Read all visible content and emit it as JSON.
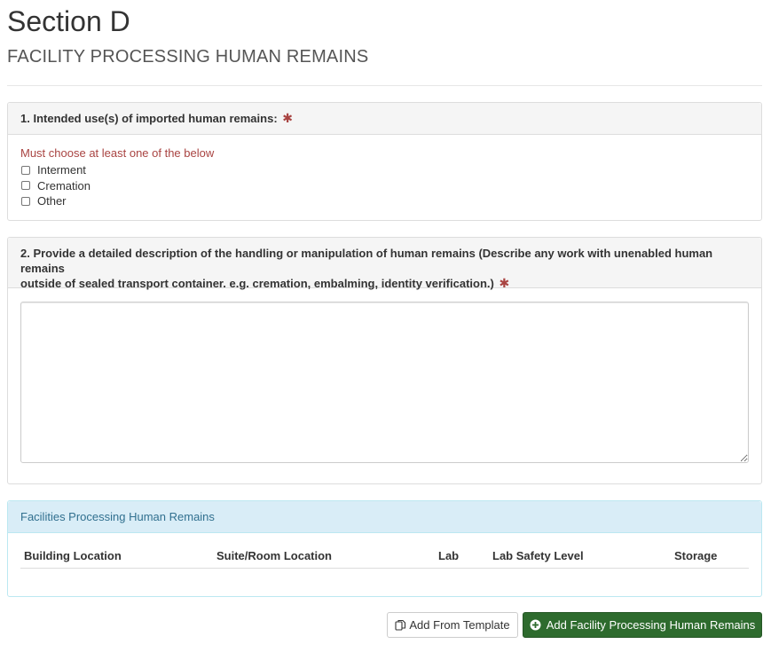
{
  "header": {
    "title": "Section D",
    "subtitle": "FACILITY PROCESSING HUMAN REMAINS"
  },
  "question1": {
    "label": "1. Intended use(s) of imported human remains:",
    "required_mark": "✱",
    "validation_message": "Must choose at least one of the below",
    "options": [
      {
        "label": "Interment",
        "checked": false
      },
      {
        "label": "Cremation",
        "checked": false
      },
      {
        "label": "Other",
        "checked": false
      }
    ]
  },
  "question2": {
    "label_line1": "2. Provide a detailed description of the handling or manipulation of human remains (Describe any work with unenabled human remains",
    "label_line2": "outside of sealed transport container. e.g. cremation, embalming, identity verification.)",
    "required_mark": "✱",
    "textarea_value": ""
  },
  "facilities": {
    "panel_title": "Facilities Processing Human Remains",
    "columns": [
      "Building Location",
      "Suite/Room Location",
      "Lab",
      "Lab Safety Level",
      "Storage"
    ],
    "rows": []
  },
  "actions": {
    "add_from_template_label": "Add From Template",
    "add_facility_label": "Add Facility Processing Human Remains"
  },
  "colors": {
    "required": "#a94442",
    "info_panel_bg": "#d9edf7",
    "info_panel_text": "#31708f",
    "primary_button_bg": "#2e6b2e"
  },
  "icons": {
    "template_button": "copy-icon",
    "add_button": "plus-circle-icon"
  }
}
